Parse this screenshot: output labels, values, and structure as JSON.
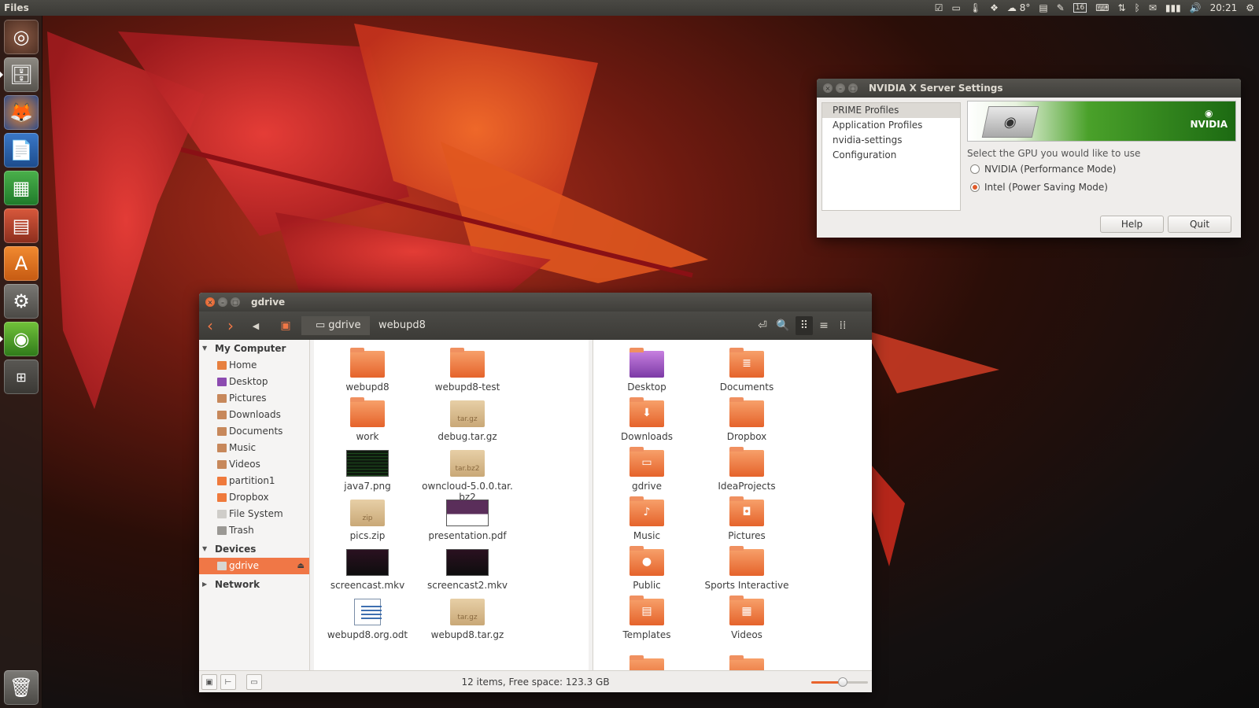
{
  "top_panel": {
    "app_title": "Files",
    "weather": "8°",
    "calendar_day": "16",
    "clock": "20:21"
  },
  "colors": {
    "accent": "#f07746",
    "nvidia_green": "#4aa12a",
    "panel": "#3c3b37"
  },
  "launcher": {
    "items": [
      "dash-home",
      "files",
      "firefox",
      "libreoffice-writer",
      "libreoffice-calc",
      "libreoffice-impress",
      "software-center",
      "system-settings",
      "nvidia-settings",
      "workspace-switcher",
      "trash"
    ]
  },
  "nvidia_window": {
    "title": "NVIDIA X Server Settings",
    "nav": [
      "PRIME Profiles",
      "Application Profiles",
      "nvidia-settings Configuration"
    ],
    "banner_logo": "NVIDIA",
    "group_label": "Select the GPU you would like to use",
    "options": [
      {
        "label": "NVIDIA (Performance Mode)",
        "selected": false
      },
      {
        "label": "Intel (Power Saving Mode)",
        "selected": true
      }
    ],
    "help_label": "Help",
    "quit_label": "Quit"
  },
  "files_window": {
    "title": "gdrive",
    "breadcrumb": [
      "gdrive",
      "webupd8"
    ],
    "sidebar": {
      "my_computer": "My Computer",
      "places": [
        {
          "label": "Home",
          "icon": "home-icon"
        },
        {
          "label": "Desktop",
          "icon": "desktop-icon"
        },
        {
          "label": "Pictures",
          "icon": "pictures-icon"
        },
        {
          "label": "Downloads",
          "icon": "downloads-icon"
        },
        {
          "label": "Documents",
          "icon": "documents-icon"
        },
        {
          "label": "Music",
          "icon": "music-icon"
        },
        {
          "label": "Videos",
          "icon": "videos-icon"
        },
        {
          "label": "partition1",
          "icon": "folder-icon"
        },
        {
          "label": "Dropbox",
          "icon": "folder-icon"
        },
        {
          "label": "File System",
          "icon": "drive-icon"
        },
        {
          "label": "Trash",
          "icon": "trash-icon"
        }
      ],
      "devices": "Devices",
      "device_items": [
        {
          "label": "gdrive",
          "icon": "drive-icon",
          "selected": true
        }
      ],
      "network": "Network"
    },
    "left_pane": [
      {
        "name": "webupd8",
        "type": "folder"
      },
      {
        "name": "webupd8-test",
        "type": "folder"
      },
      {
        "name": "work",
        "type": "folder"
      },
      {
        "name": "debug.tar.gz",
        "type": "archive",
        "badge": "tar.gz"
      },
      {
        "name": "java7.png",
        "type": "terminal-shot"
      },
      {
        "name": "owncloud-5.0.0.tar.\nbz2",
        "type": "archive",
        "badge": "tar.bz2"
      },
      {
        "name": "pics.zip",
        "type": "archive",
        "badge": "zip"
      },
      {
        "name": "presentation.pdf",
        "type": "pdf"
      },
      {
        "name": "screencast.mkv",
        "type": "video-shot"
      },
      {
        "name": "screencast2.mkv",
        "type": "video-shot"
      },
      {
        "name": "webupd8.org.odt",
        "type": "document"
      },
      {
        "name": "webupd8.tar.gz",
        "type": "archive",
        "badge": "tar.gz"
      }
    ],
    "right_pane": [
      {
        "name": "Desktop",
        "type": "desktop-folder"
      },
      {
        "name": "Documents",
        "type": "folder",
        "emblem": "document-emblem"
      },
      {
        "name": "Downloads",
        "type": "folder",
        "emblem": "download-emblem"
      },
      {
        "name": "Dropbox",
        "type": "folder"
      },
      {
        "name": "gdrive",
        "type": "folder",
        "emblem": "drive-emblem"
      },
      {
        "name": "IdeaProjects",
        "type": "folder"
      },
      {
        "name": "Music",
        "type": "folder",
        "emblem": "music-emblem"
      },
      {
        "name": "Pictures",
        "type": "folder",
        "emblem": "camera-emblem"
      },
      {
        "name": "Public",
        "type": "folder",
        "emblem": "person-emblem"
      },
      {
        "name": "Sports Interactive",
        "type": "folder"
      },
      {
        "name": "Templates",
        "type": "folder",
        "emblem": "template-emblem"
      },
      {
        "name": "Videos",
        "type": "folder",
        "emblem": "film-emblem"
      }
    ],
    "status": "12 items, Free space: 123.3 GB",
    "zoom_level": 0.55
  }
}
